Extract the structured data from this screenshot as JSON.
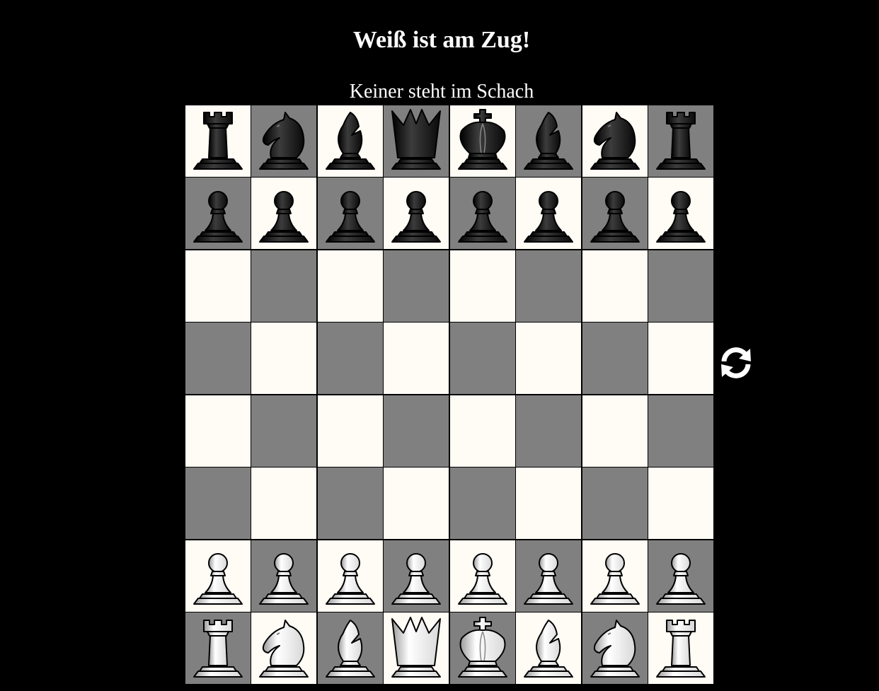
{
  "title": "Weiß ist am Zug!",
  "status": "Keiner steht im Schach",
  "colors": {
    "light_square": "#fffbf5",
    "dark_square": "#808080",
    "background": "#000000",
    "text": "#ffffff"
  },
  "board": {
    "ranks": [
      [
        "br",
        "bn",
        "bb",
        "bq",
        "bk",
        "bb",
        "bn",
        "br"
      ],
      [
        "bp",
        "bp",
        "bp",
        "bp",
        "bp",
        "bp",
        "bp",
        "bp"
      ],
      [
        "",
        "",
        "",
        "",
        "",
        "",
        "",
        ""
      ],
      [
        "",
        "",
        "",
        "",
        "",
        "",
        "",
        ""
      ],
      [
        "",
        "",
        "",
        "",
        "",
        "",
        "",
        ""
      ],
      [
        "",
        "",
        "",
        "",
        "",
        "",
        "",
        ""
      ],
      [
        "wp",
        "wp",
        "wp",
        "wp",
        "wp",
        "wp",
        "wp",
        "wp"
      ],
      [
        "wr",
        "wn",
        "wb",
        "wq",
        "wk",
        "wb",
        "wn",
        "wr"
      ]
    ]
  },
  "rotate_button": {
    "icon": "rotate-board-icon"
  }
}
